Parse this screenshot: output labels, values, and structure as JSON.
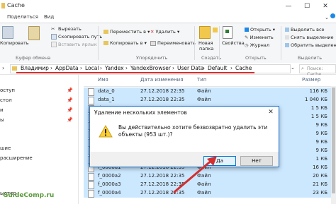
{
  "window": {
    "title": "Cache",
    "minimize": "—",
    "maximize": "☐",
    "close": "✕"
  },
  "tabs": [
    "Поделиться",
    "Вид"
  ],
  "ribbon": {
    "copy_to_clipboard": "Копировать",
    "cut": "Вырезать",
    "copy_path": "Скопировать путь",
    "paste_shortcut": "Вставить ярлык",
    "group_clipboard": "Буфер обмена",
    "move_to": "Переместить в ▾",
    "copy_to": "Копировать в ▾",
    "delete": "Удалить ▾",
    "rename": "Переименовать",
    "group_organize": "Упорядочить",
    "new_folder_l1": "Новая",
    "new_folder_l2": "папка",
    "group_new": "Создать",
    "properties_l1": "Свойства",
    "open": "Открыть ▾",
    "edit": "Изменить",
    "journal": "Журнал",
    "group_open": "Открыть",
    "select_all": "Выделить все",
    "select_none": "Снять выделение",
    "invert_selection": "Обратить выделение",
    "group_select": "Выделить"
  },
  "address": {
    "crumbs": [
      "Владимир",
      "AppData",
      "Local",
      "Yandex",
      "YandexBrowser",
      "User Data",
      "Default",
      "Cache"
    ],
    "search_placeholder": "Поиск: Cache"
  },
  "nav": {
    "items": [
      "оступ",
      "стол",
      "и",
      "ы",
      "шиe",
      "расширение",
      "ьютер"
    ]
  },
  "columns": {
    "name": "Имя",
    "date": "Дата изменения",
    "type": "Тип",
    "size": "Размер"
  },
  "rows": [
    {
      "name": "data_0",
      "date": "27.12.2018 22:35",
      "type": "Файл",
      "size": "116 КБ"
    },
    {
      "name": "data_1",
      "date": "27.12.2018 22:35",
      "type": "Файл",
      "size": "1 040 КБ"
    },
    {
      "name": "data_2",
      "date": "",
      "type": "",
      "size": "1 5 КБ"
    },
    {
      "name": "data_3",
      "date": "",
      "type": "",
      "size": "1 5 КБ"
    },
    {
      "name": "f_000001",
      "date": "",
      "type": "",
      "size": "9 КБ"
    },
    {
      "name": "f_000002",
      "date": "",
      "type": "",
      "size": "9 КБ"
    },
    {
      "name": "f_000003",
      "date": "",
      "type": "",
      "size": "9 КБ"
    },
    {
      "name": "f_000004",
      "date": "",
      "type": "",
      "size": "9 КБ"
    },
    {
      "name": "f_000005",
      "date": "",
      "type": "",
      "size": "1 КБ"
    },
    {
      "name": "f_0000a1",
      "date": "27.12.2018 22:35",
      "type": "Файл",
      "size": "16 КБ"
    },
    {
      "name": "f_0000a2",
      "date": "27.12.2018 22:35",
      "type": "Файл",
      "size": "20 КБ"
    },
    {
      "name": "f_0000a3",
      "date": "27.12.2018 22:35",
      "type": "Файл",
      "size": "21 КБ"
    },
    {
      "name": "f_0000a4",
      "date": "27.12.2018 22:35",
      "type": "Файл",
      "size": "23 КБ"
    }
  ],
  "dialog": {
    "title": "Удаление нескольких элементов",
    "message": "Вы действительно хотите безвозвратно удалить эти объекты (953 шт.)?",
    "yes": "Да",
    "no": "Нет"
  },
  "watermark": "GuideComp.ru",
  "colors": {
    "selection": "#cce8ff",
    "accent": "#0078d7",
    "arrow": "#d32f2f"
  }
}
